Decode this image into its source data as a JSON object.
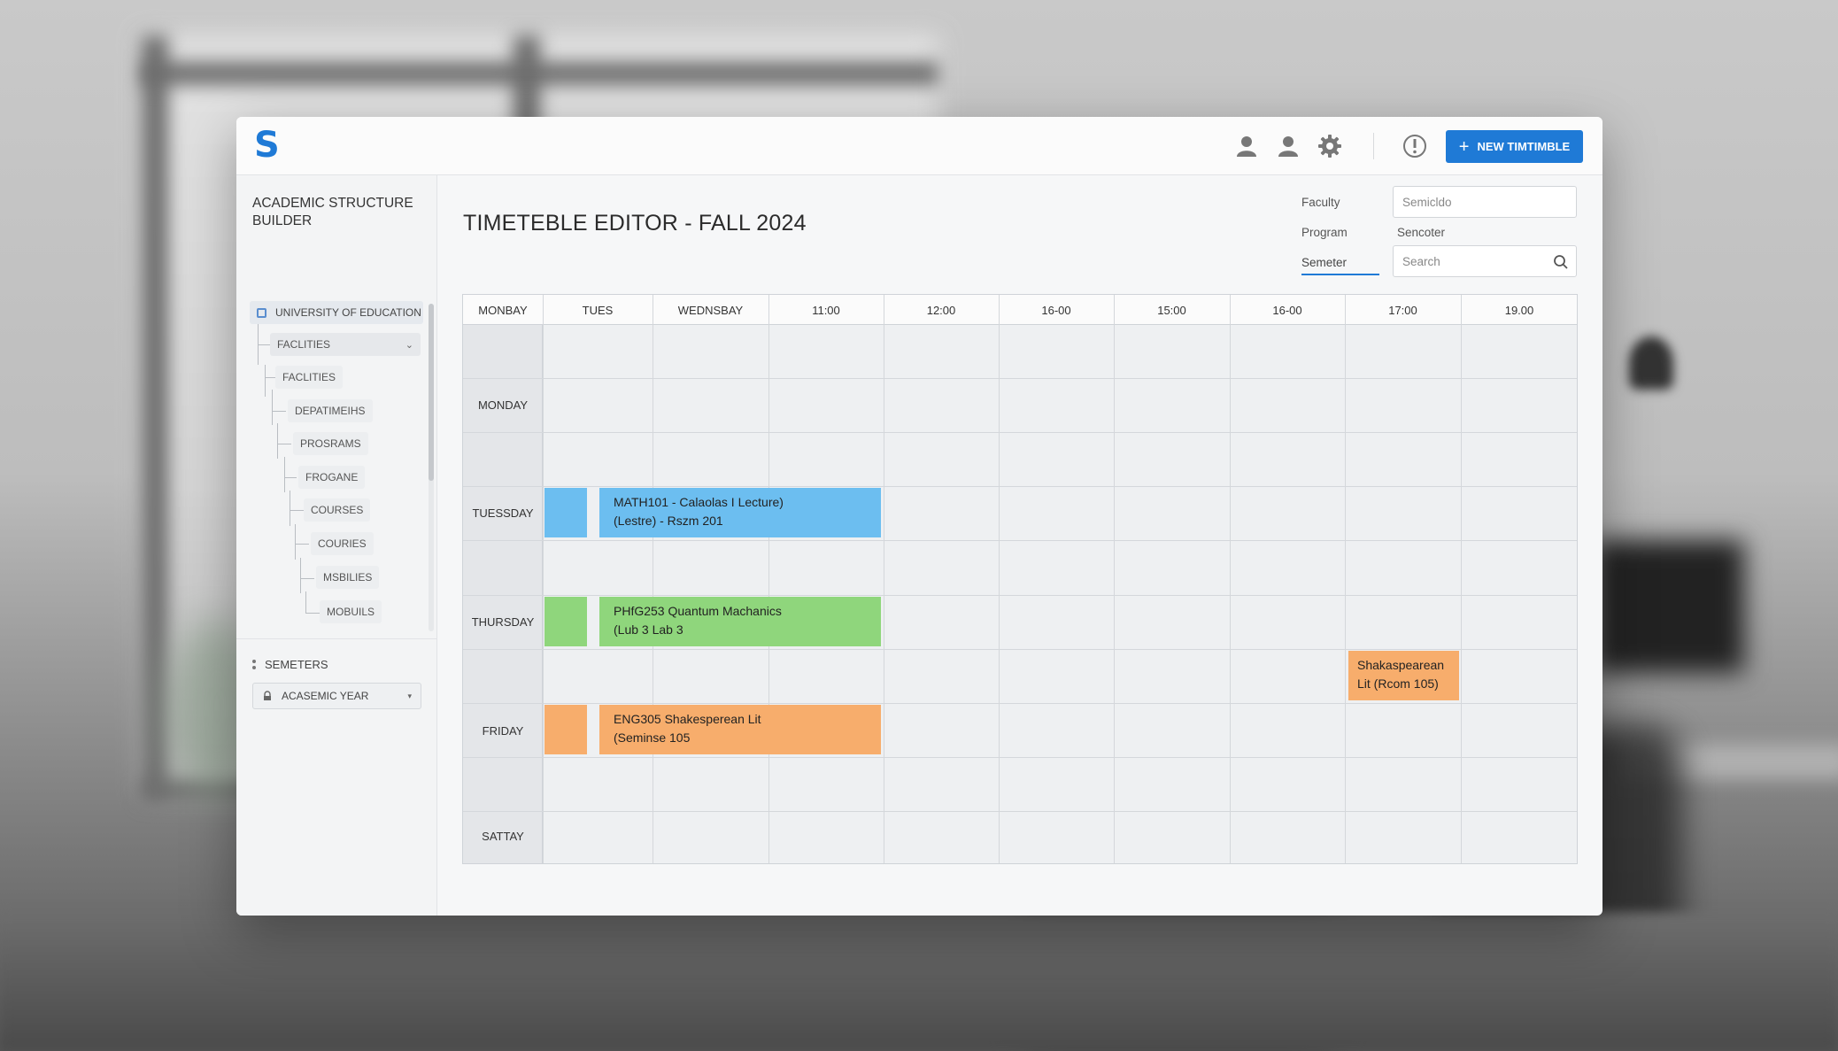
{
  "app": {
    "logo_text": "S",
    "new_button_label": "NEW TIMTIMBLE",
    "new_button_icon": "plus-icon",
    "top_icons": [
      "user-icon",
      "user-icon",
      "gear-icon",
      "info-icon"
    ]
  },
  "sidebar": {
    "title": "ACADEMIC STRUCTURE BUILDER",
    "root": "UNIVERSITY OF EDUCATION",
    "items": [
      {
        "label": "FACLITIES"
      },
      {
        "label": "FACLITIES"
      },
      {
        "label": "DEPATIMEIHS"
      },
      {
        "label": "PROSRAMS"
      },
      {
        "label": "FROGANE"
      },
      {
        "label": "COURSES"
      },
      {
        "label": "COURIES"
      },
      {
        "label": "MSBILIES"
      },
      {
        "label": "MOBUILS"
      }
    ],
    "semesters_label": "SEMETERS",
    "year_select": "ACASEMIC YEAR"
  },
  "main": {
    "title": "TIMETEBLE EDITOR - FALL 2024",
    "filters": {
      "faculty_label": "Faculty",
      "program_label": "Program",
      "semester_label": "Semeter",
      "semester_value_placeholder": "Semicldo",
      "semester_caption": "Sencoter",
      "search_placeholder": "Search"
    }
  },
  "grid": {
    "headers": [
      "MONBAY",
      "TUES",
      "WEDNSBAY",
      "11:00",
      "12:00",
      "16-00",
      "15:00",
      "16-00",
      "17:00",
      "19.00"
    ],
    "days": [
      "MONDAY",
      "TUESSDAY",
      "THURSDAY",
      "FRIDAY",
      "SATTAY"
    ],
    "events": [
      {
        "line1": "MATH101 - Calaolas I Lecture)",
        "line2": "(Lestre) - Rszm 201",
        "color": "#6cbef0"
      },
      {
        "line1": "PHfG253 Quantum Machanics",
        "line2": "(Lub 3 Lab 3",
        "color": "#8fd67c"
      },
      {
        "line1": "ENG305 Shakesperean Lit",
        "line2": "(Seminse 105",
        "color": "#f7ad6c"
      },
      {
        "line1": "Shakaspearean",
        "line2": "Lit (Rcom 105)",
        "color": "#f7ad6c"
      }
    ]
  }
}
